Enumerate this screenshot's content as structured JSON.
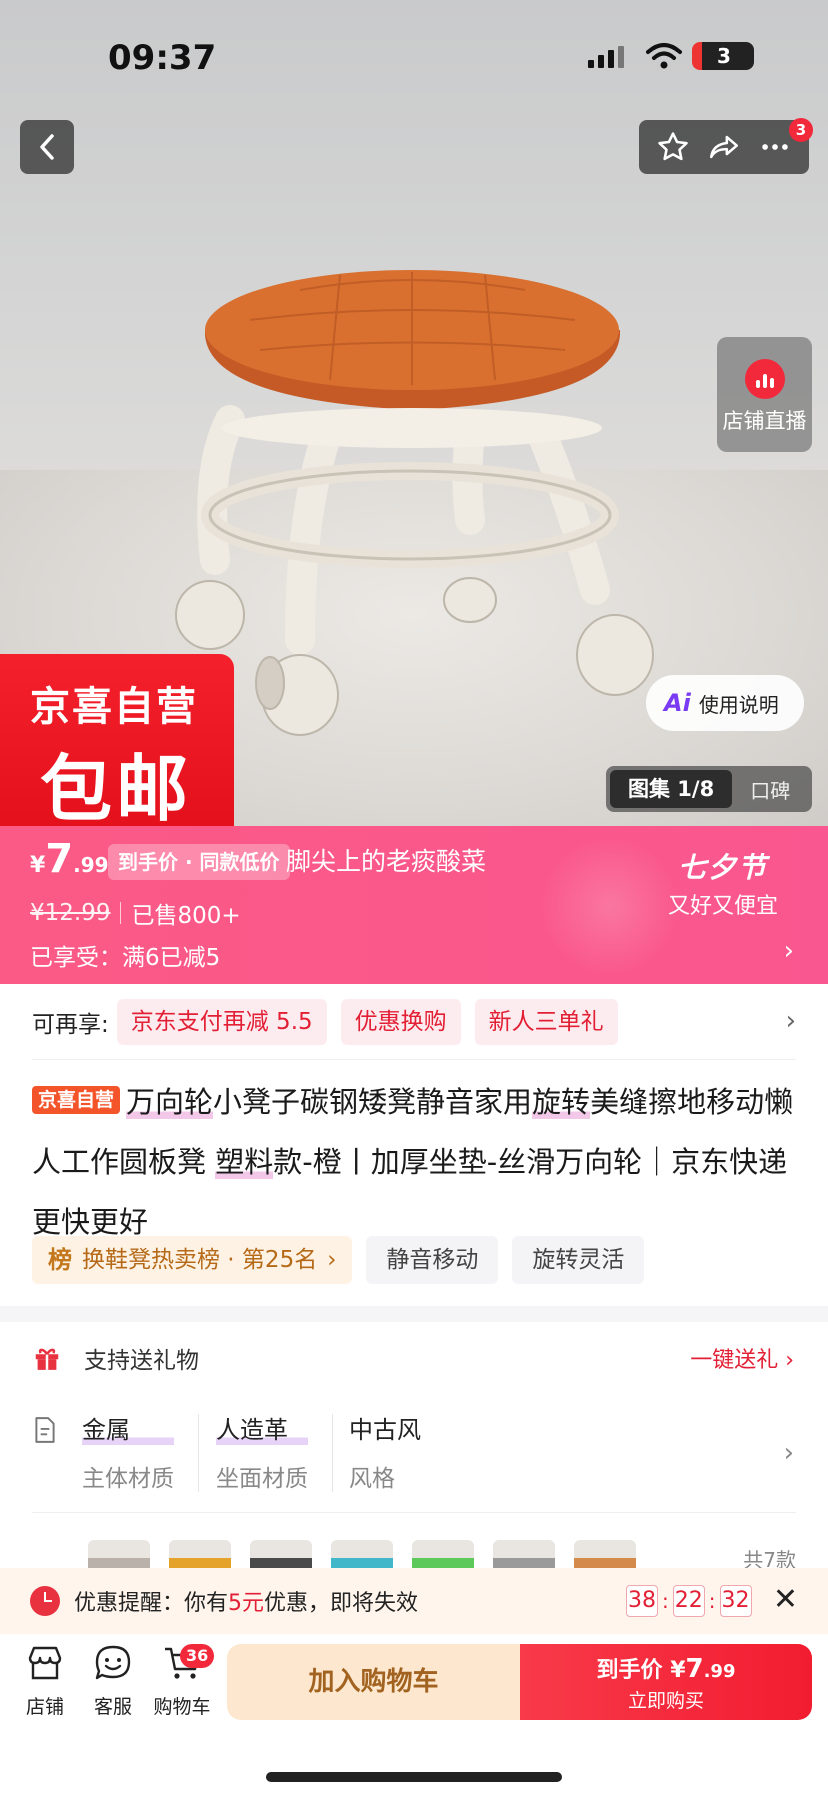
{
  "status_bar": {
    "time": "09:37",
    "battery": "3"
  },
  "header": {
    "more_badge": "3"
  },
  "hero": {
    "live_label": "店铺直播",
    "badge_line1": "京喜自营",
    "badge_line2": "包邮",
    "ai_label": "使用说明",
    "gallery_label": "图集 1/8",
    "review_label": "口碑"
  },
  "price": {
    "currency": "¥",
    "integer": "7",
    "decimal": ".99",
    "tag": "到手价 · 同款低价",
    "shop_name": "脚尖上的老痰酸菜",
    "original": "¥12.99",
    "sold": "已售800+",
    "discount_applied": "已享受：满6已减5",
    "festival": "七夕节",
    "festival_sub": "又好又便宜"
  },
  "promos": {
    "label": "可再享:",
    "chips": [
      "京东支付再减 5.5",
      "优惠换购",
      "新人三单礼"
    ]
  },
  "title": {
    "badge": "京喜自营",
    "seg1": "万向轮",
    "seg2": "小凳子碳钢矮凳静音家用",
    "seg3": "旋转",
    "seg4": "美缝擦地移动懒人工作圆板凳 ",
    "seg5": "塑料",
    "seg6": "款-橙丨加厚坐垫-丝滑万向轮",
    "seg7": "｜京东快递 更快更好"
  },
  "tags": {
    "rank_icon": "榜",
    "rank": "换鞋凳热卖榜 · 第25名",
    "items": [
      "静音移动",
      "旋转灵活"
    ]
  },
  "gift": {
    "label": "支持送礼物",
    "action": "一键送礼"
  },
  "attrs": [
    {
      "value": "金属",
      "key": "主体材质"
    },
    {
      "value": "人造革",
      "key": "坐面材质"
    },
    {
      "value": "中古风",
      "key": "风格"
    }
  ],
  "thumbs": {
    "colors": [
      "#b9b1aa",
      "#e5a32b",
      "#4a4a4a",
      "#41b7c9",
      "#5cc95a",
      "#9a9a9a",
      "#d38a4a"
    ],
    "more": "共7款"
  },
  "reminder": {
    "prefix": "优惠提醒：你有",
    "amount": "5元",
    "suffix": "优惠，即将失效",
    "h": "38",
    "m": "22",
    "s": "32"
  },
  "bottom": {
    "shop": "店铺",
    "service": "客服",
    "cart": "购物车",
    "cart_count": "36",
    "add_cart": "加入购物车",
    "buy_prefix": "到手价",
    "buy_currency": "¥",
    "buy_int": "7",
    "buy_dec": ".99",
    "buy_now": "立即购买"
  }
}
